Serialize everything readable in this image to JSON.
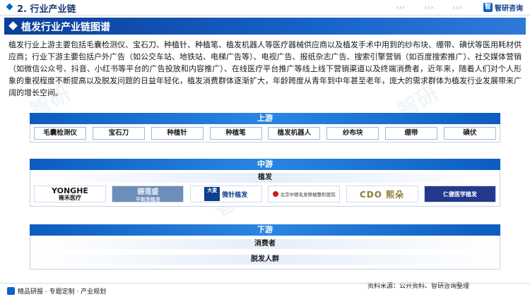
{
  "header": {
    "section_title": "2. 行业产业链",
    "brand": "智研咨询"
  },
  "banner": {
    "title": "植发行业产业链图谱"
  },
  "paragraph": "植发行业上游主要包括毛囊检测仪、宝石刀、种植针、种植笔、植发机器人等医疗器械供应商以及植发手术中用到的纱布块、绷带、碘伏等医用耗材供应商；行业下游主要包括户外广告（如公交车站、地铁站、电梯广告等）、电视广告、报纸杂志广告、搜索引擎营销（如百度搜索推广）、社交媒体营销（如微信公众号、抖音、小红书等平台的广告投放和内容推广）、在线医疗平台推广等线上线下营销渠道以及终端消费者，近年来，随着人们对个人形象的重视程度不断提高以及脱发问题的日益年轻化，植发消费群体逐渐扩大，年龄跨度从青年到中年甚至老年，庞大的需求群体为植发行业发展带来广阔的增长空间。",
  "upstream": {
    "label": "上游",
    "items": [
      "毛囊检测仪",
      "宝石刀",
      "种植针",
      "种植笔",
      "植发机器人",
      "纱布块",
      "绷带",
      "碘伏"
    ]
  },
  "midstream": {
    "label": "中游",
    "sub_label": "植发",
    "logos": [
      {
        "line1": "YONGHE",
        "line2": "雍禾医疗"
      },
      {
        "line1": "碧莲盛",
        "line2": "不剃发植发"
      },
      {
        "line1": "大麦",
        "line2": "微针植发"
      },
      {
        "line1": "北京中德毛发移植整形医院"
      },
      {
        "line1": "CDO 熙朵"
      },
      {
        "line1": "仁健医学植发"
      }
    ]
  },
  "downstream": {
    "label": "下游",
    "items": [
      "消费者",
      "脱发人群"
    ]
  },
  "footer": {
    "left": "精品研报 · 专题定制 · 产业规划",
    "source": "资料来源：公开资料、智研咨询整理"
  },
  "colors": {
    "primary": "#0a63c8",
    "banner_dark": "#0b3f97",
    "band": "#1f74d6"
  }
}
